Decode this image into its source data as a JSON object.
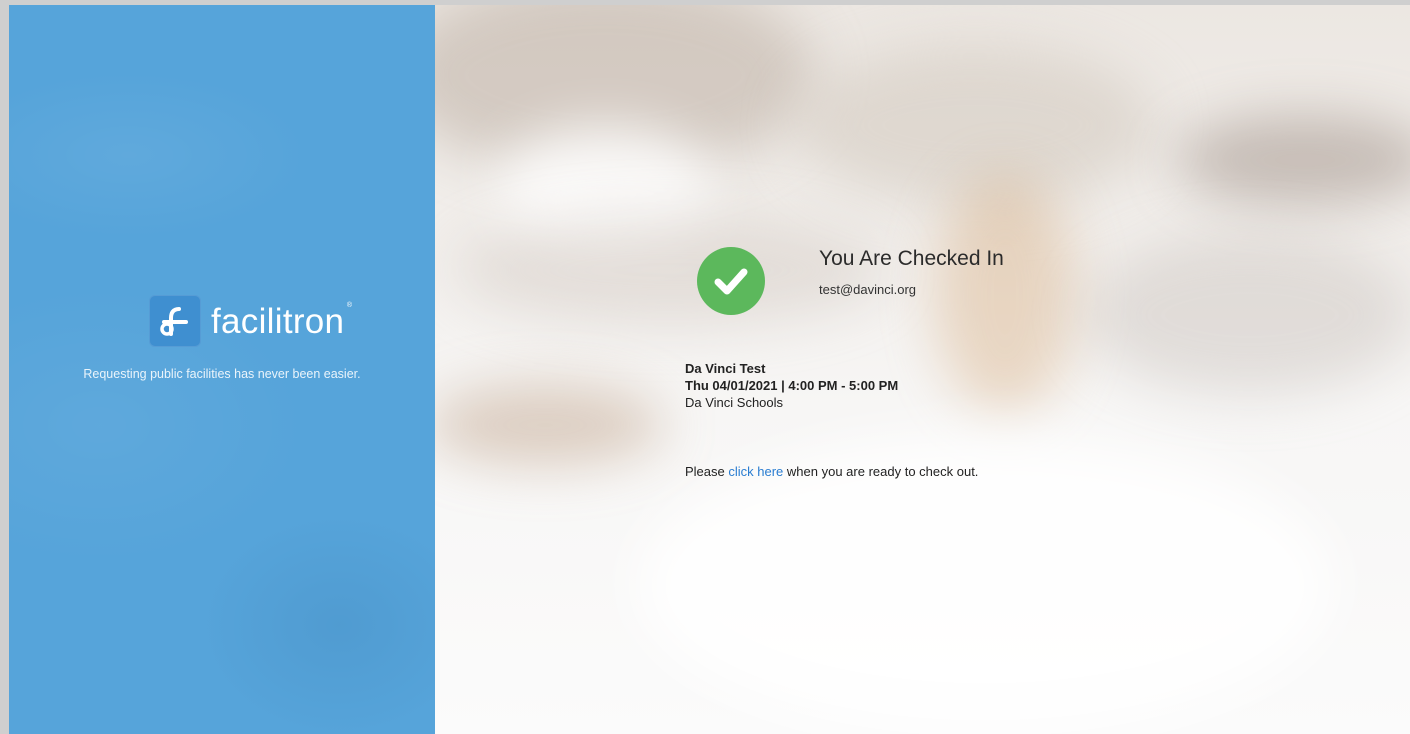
{
  "brand": {
    "name": "facilitron",
    "registered": "®",
    "tagline": "Requesting public facilities has never been easier.",
    "logo_icon": "facilitron-f-logo-icon",
    "panel_color": "#56a4da"
  },
  "checkin": {
    "status_icon": "check-circle-icon",
    "status_color": "#5cb85c",
    "title": "You Are Checked In",
    "email": "test@davinci.org"
  },
  "event": {
    "name": "Da Vinci Test",
    "datetime": "Thu 04/01/2021 | 4:00 PM - 5:00 PM",
    "organization": "Da Vinci Schools"
  },
  "checkout": {
    "prefix": "Please ",
    "link_label": "click here",
    "suffix": " when you are ready to check out.",
    "link_color": "#2a7dd1"
  }
}
